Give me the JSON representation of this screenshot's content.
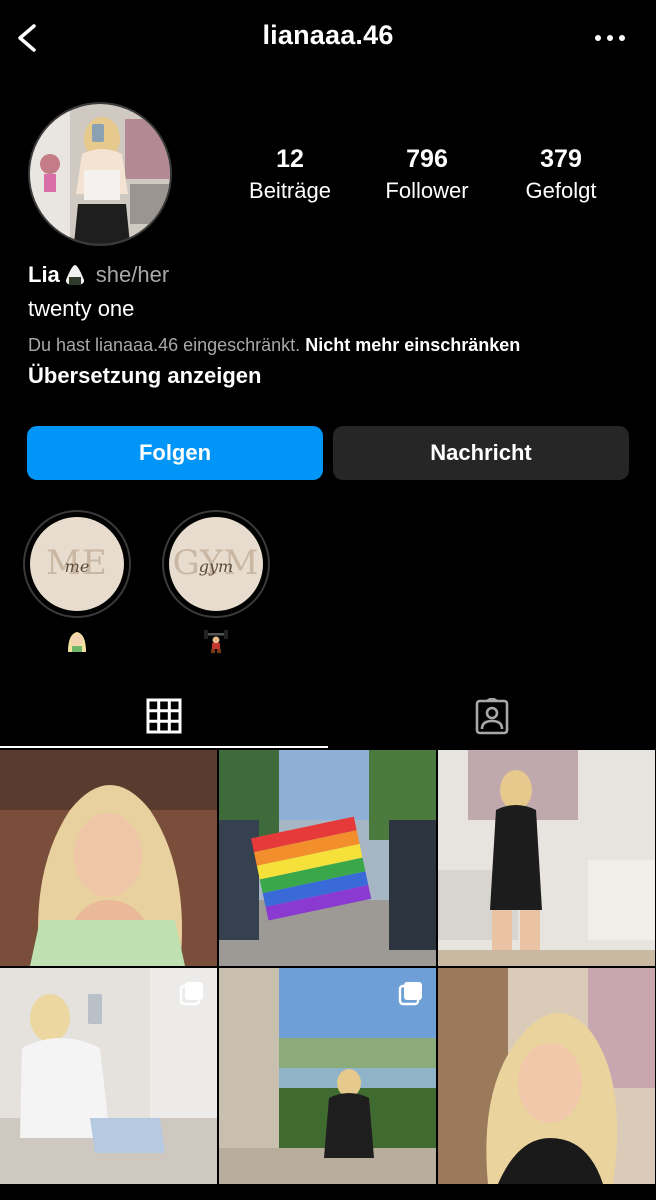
{
  "header": {
    "username": "lianaaa.46"
  },
  "profile": {
    "stats": [
      {
        "value": "12",
        "label": "Beiträge"
      },
      {
        "value": "796",
        "label": "Follower"
      },
      {
        "value": "379",
        "label": "Gefolgt"
      }
    ],
    "name": "Lia",
    "name_emoji": "onigiri-icon",
    "pronouns": "she/her",
    "bio": "twenty one",
    "restricted_notice": "Du hast lianaaa.46 eingeschränkt.",
    "unrestrict_label": "Nicht mehr einschränken",
    "translate_label": "Übersetzung anzeigen"
  },
  "actions": {
    "follow_label": "Folgen",
    "message_label": "Nachricht"
  },
  "highlights": [
    {
      "cover_big": "ME",
      "cover_small": "me",
      "label_icon": "woman-emoji-icon"
    },
    {
      "cover_big": "GYM",
      "cover_small": "gym",
      "label_icon": "weightlifter-emoji-icon"
    }
  ],
  "tabs": [
    {
      "name": "posts-grid-icon",
      "active": true
    },
    {
      "name": "tagged-icon",
      "active": false
    }
  ],
  "posts": [
    {
      "multi": false
    },
    {
      "multi": false
    },
    {
      "multi": false
    },
    {
      "multi": true
    },
    {
      "multi": true
    },
    {
      "multi": false
    }
  ],
  "colors": {
    "accent": "#0095f6",
    "secondary_button": "#262626",
    "muted_text": "#a8a8a8",
    "background": "#000000"
  }
}
